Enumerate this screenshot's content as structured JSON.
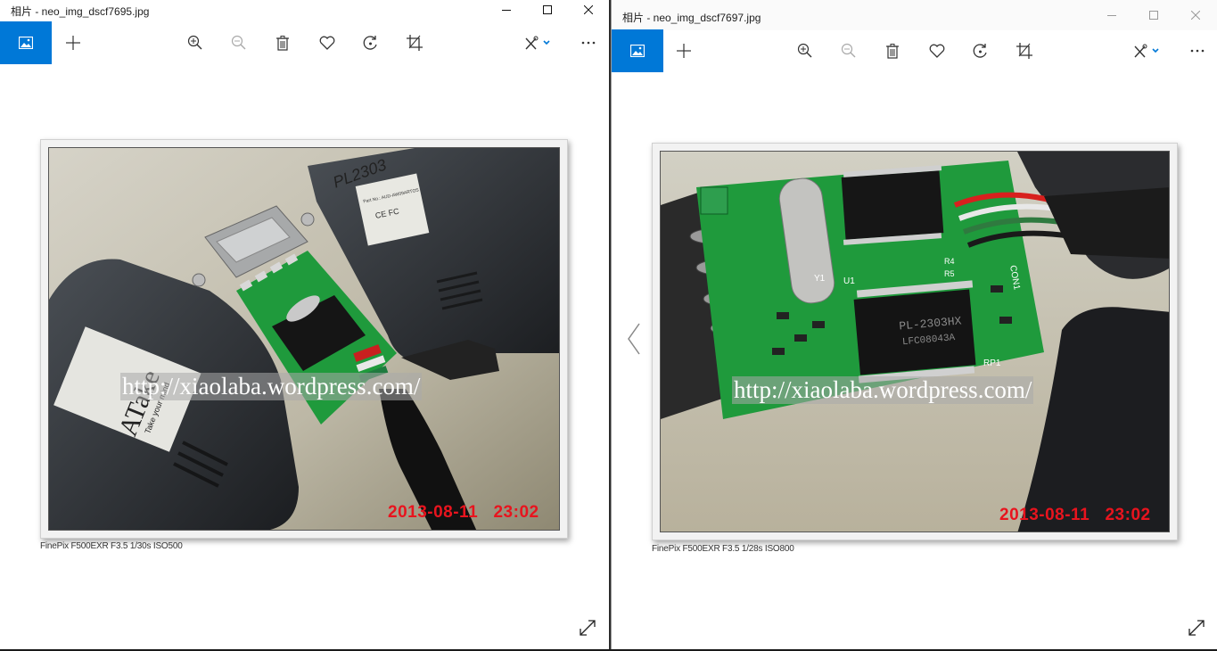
{
  "windows": {
    "left": {
      "title": "相片 - neo_img_dscf7695.jpg",
      "watermark": "http://xiaolaba.wordpress.com/",
      "date_stamp": "2013-08-11   23:02",
      "exif": "FinePix F500EXR F3.5 1/30s ISO500"
    },
    "right": {
      "title": "相片 - neo_img_dscf7697.jpg",
      "watermark": "http://xiaolaba.wordpress.com/",
      "date_stamp": "2013-08-11   23:02",
      "exif": "FinePix F500EXR F3.5 1/28s ISO800"
    }
  },
  "photo_labels": {
    "left_adapter_tag": "PL2303",
    "left_label_line1": "Part No.: AUD-AW09ARTOS",
    "left_label_ce": "CE FC",
    "left_brand": "ATake",
    "left_brand_sub": "Take your mind",
    "right_chip": "PL-2303HX",
    "right_chip_sub": "LFC08043A",
    "right_silk_u1": "U1",
    "right_silk_y1": "Y1",
    "right_silk_con1": "CON1",
    "right_silk_rp1": "RP1",
    "right_silk_r4": "R4",
    "right_silk_r5": "R5"
  },
  "colors": {
    "accent": "#0078d7",
    "date_stamp": "#e8141e",
    "pcb_green": "#1f9a3c"
  }
}
